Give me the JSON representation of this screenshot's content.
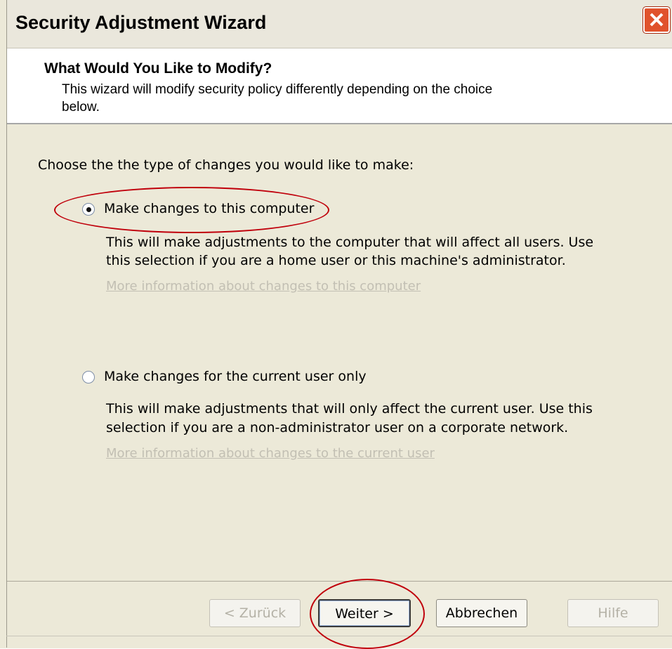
{
  "window": {
    "title": "Security Adjustment Wizard",
    "close_icon": "close-x-icon"
  },
  "header": {
    "title": "What Would You Like to Modify?",
    "description_line1": "This wizard will modify security policy differently depending on the choice",
    "description_line2": "below."
  },
  "body": {
    "prompt": "Choose the the type of changes you would like to make:",
    "options": [
      {
        "label": "Make changes to this computer",
        "selected": true,
        "description_line1": "This will make adjustments to the computer that will affect all users.  Use",
        "description_line2": "this selection if you are a home user or this machine's administrator.",
        "link": "More information about changes to this computer"
      },
      {
        "label": "Make changes for the current user only",
        "selected": false,
        "description_line1": "This will make adjustments that will only affect the current user.  Use this",
        "description_line2": "selection if you are a non-administrator user on a corporate network.",
        "link": "More information about changes to the current user"
      }
    ]
  },
  "footer": {
    "back_label": "< Zurück",
    "next_label": "Weiter >",
    "cancel_label": "Abbrechen",
    "help_label": "Hilfe"
  },
  "colors": {
    "annotation": "#c0000b",
    "title_close": "#e0522c"
  }
}
